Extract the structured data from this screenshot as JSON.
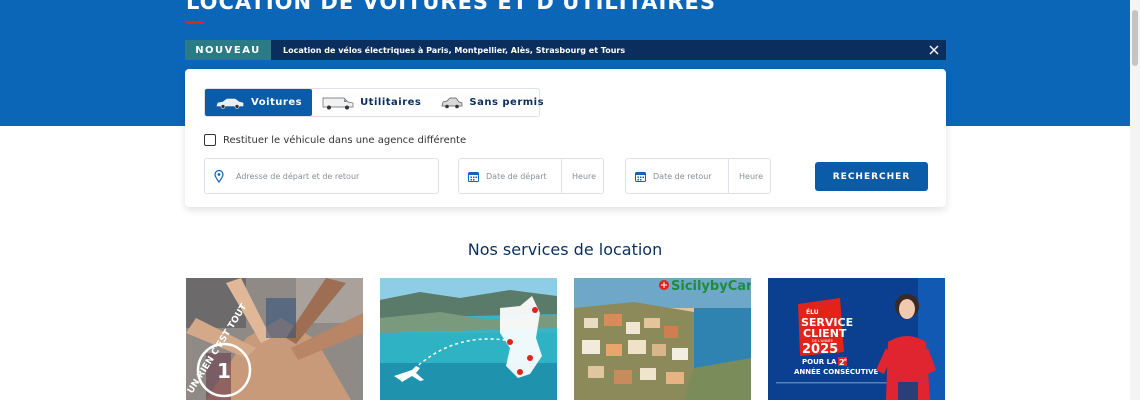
{
  "hero": {
    "title": "LOCATION DE VOITURES ET D'UTILITAIRES"
  },
  "news": {
    "badge": "NOUVEAU",
    "text": "Location de vélos électriques à Paris, Montpellier, Alès, Strasbourg et Tours",
    "close_icon": "close-icon"
  },
  "search": {
    "tabs": [
      {
        "label": "Voitures",
        "icon": "car-icon",
        "active": true
      },
      {
        "label": "Utilitaires",
        "icon": "van-icon",
        "active": false
      },
      {
        "label": "Sans permis",
        "icon": "small-car-icon",
        "active": false
      }
    ],
    "return_label": "Restituer le véhicule dans une agence différente",
    "address_placeholder": "Adresse de départ et de retour",
    "start_date_placeholder": "Date de départ",
    "start_time_placeholder": "Heure",
    "end_date_placeholder": "Date de retour",
    "end_time_placeholder": "Heure",
    "search_button": "RECHERCHER"
  },
  "services": {
    "title": "Nos services de location",
    "cards": [
      {
        "text": "UN RIEN C'EST TOUT",
        "number": "1"
      },
      {
        "text": ""
      },
      {
        "logo": "SicilybyCar"
      },
      {
        "line1": "ÉLU",
        "line2": "SERVICE",
        "line3": "CLIENT",
        "small": "DE L'ANNÉE",
        "year": "2025",
        "pour": "POUR LA",
        "ordinal": "2",
        "ordinal_sup": "e",
        "annee": "ANNÉE CONSÉCUTIVE"
      }
    ]
  },
  "colors": {
    "brand_blue": "#0b66b8",
    "dark_navy": "#0a2f5e",
    "badge_teal": "#2b7b86",
    "accent_red": "#e2231a"
  }
}
